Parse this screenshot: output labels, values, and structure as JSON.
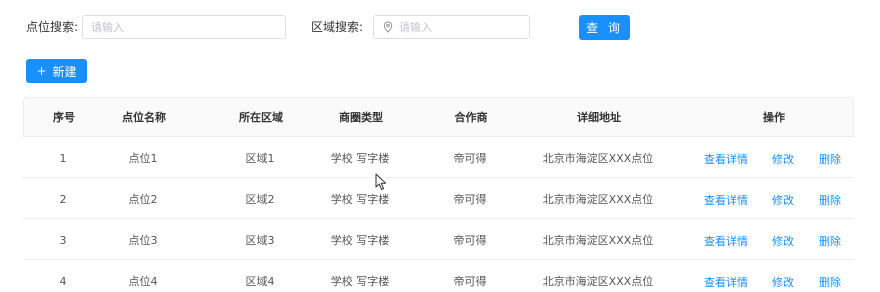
{
  "filters": {
    "point_label": "点位搜索:",
    "point_placeholder": "请输入",
    "area_label": "区域搜索:",
    "area_placeholder": "请输入",
    "search_button": "查 询"
  },
  "toolbar": {
    "new_button": "新建"
  },
  "table": {
    "headers": {
      "no": "序号",
      "name": "点位名称",
      "area": "所在区域",
      "type": "商圈类型",
      "partner": "合作商",
      "address": "详细地址",
      "ops": "操作"
    },
    "rows": [
      {
        "no": "1",
        "name": "点位1",
        "area": "区域1",
        "type": "学校 写字楼",
        "partner": "帝可得",
        "address": "北京市海淀区XXX点位",
        "view": "查看详情",
        "edit": "修改",
        "delete": "删除"
      },
      {
        "no": "2",
        "name": "点位2",
        "area": "区域2",
        "type": "学校 写字楼",
        "partner": "帝可得",
        "address": "北京市海淀区XXX点位",
        "view": "查看详情",
        "edit": "修改",
        "delete": "删除"
      },
      {
        "no": "3",
        "name": "点位3",
        "area": "区域3",
        "type": "学校 写字楼",
        "partner": "帝可得",
        "address": "北京市海淀区XXX点位",
        "view": "查看详情",
        "edit": "修改",
        "delete": "删除"
      },
      {
        "no": "4",
        "name": "点位4",
        "area": "区域4",
        "type": "学校 写字楼",
        "partner": "帝可得",
        "address": "北京市海淀区XXX点位",
        "view": "查看详情",
        "edit": "修改",
        "delete": "删除"
      }
    ]
  },
  "colors": {
    "primary": "#1890ff",
    "border": "#ebeef5",
    "header_bg": "#fafafa"
  },
  "icons": {
    "area_input_icon": "location-pin-icon",
    "new_button_icon": "plus-icon",
    "cursor": "mouse-pointer-icon"
  }
}
